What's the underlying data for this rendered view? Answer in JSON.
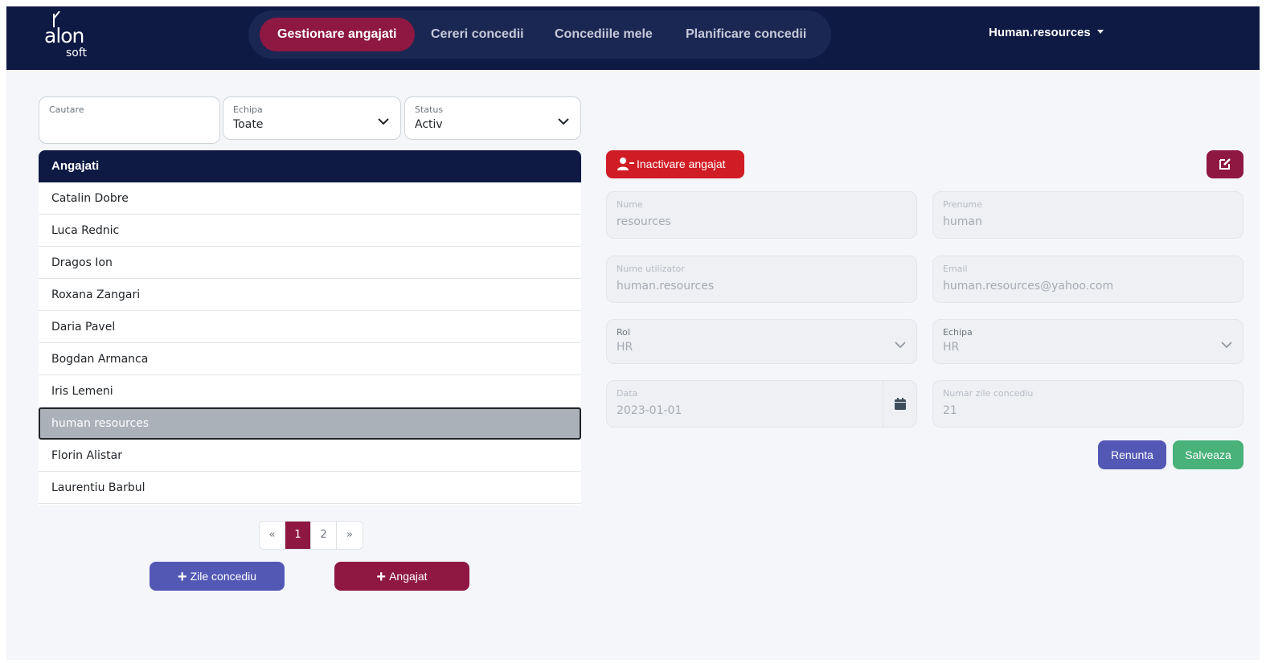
{
  "brand": {
    "main": "alon",
    "sub": "soft"
  },
  "nav": {
    "items": [
      {
        "label": "Gestionare angajati"
      },
      {
        "label": "Cereri concedii"
      },
      {
        "label": "Concediile mele"
      },
      {
        "label": "Planificare concedii"
      }
    ],
    "user": "Human.resources"
  },
  "filters": {
    "search": {
      "label": "Cautare",
      "value": ""
    },
    "team": {
      "label": "Echipa",
      "value": "Toate"
    },
    "status": {
      "label": "Status",
      "value": "Activ"
    }
  },
  "employees": {
    "header": "Angajati",
    "rows": [
      "Catalin Dobre",
      "Luca Rednic",
      "Dragos Ion",
      "Roxana Zangari",
      "Daria Pavel",
      "Bogdan Armanca",
      "Iris Lemeni",
      "human resources",
      "Florin Alistar",
      "Laurentiu Barbul"
    ],
    "selected_index": 7
  },
  "pagination": {
    "prev": "«",
    "pages": [
      "1",
      "2"
    ],
    "next": "»",
    "current": "1"
  },
  "actions": {
    "add_days": "Zile concediu",
    "add_employee": "Angajat"
  },
  "detail": {
    "inactivate_label": "Inactivare angajat",
    "fields": {
      "nume": {
        "label": "Nume",
        "value": "resources"
      },
      "prenume": {
        "label": "Prenume",
        "value": "human"
      },
      "username": {
        "label": "Nume utilizator",
        "value": "human.resources"
      },
      "email": {
        "label": "Email",
        "value": "human.resources@yahoo.com"
      },
      "rol": {
        "label": "Rol",
        "value": "HR"
      },
      "echipa": {
        "label": "Echipa",
        "value": "HR"
      },
      "data": {
        "label": "Data",
        "value": "2023-01-01"
      },
      "zile": {
        "label": "Numar zile concediu",
        "value": "21"
      }
    },
    "cancel_label": "Renunta",
    "save_label": "Salveaza"
  },
  "colors": {
    "navbar": "#0e1a44",
    "accent": "#8e1841",
    "danger": "#d01c24",
    "primary_blue": "#5358b5",
    "success": "#48b27a"
  }
}
